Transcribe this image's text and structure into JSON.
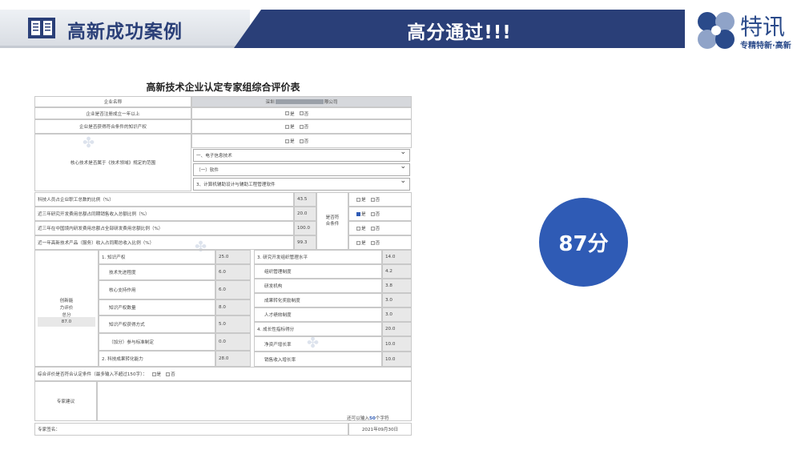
{
  "header": {
    "left_title": "高新成功案例",
    "mid_title": "高分通过!!!",
    "logo_name": "特讯",
    "logo_slogan": "专精特新·高新"
  },
  "score_badge": "87分",
  "form": {
    "title": "高新技术企业认定专家组综合评价表",
    "company_label": "企业名称",
    "company_value_left": "深圳",
    "company_value_right": "限公司",
    "row_reg_label": "企业是否注册成立一年以上",
    "row_ip_label": "企业是否获得符合条件的知识产权",
    "yes": "是",
    "no": "否",
    "tech_field_label": "核心技术是否属于《技术领域》规定的范围",
    "tech_field_1": "一、电子信息技术",
    "tech_field_2": "（一）软件",
    "tech_field_3": "3、计算机辅助设计与辅助工程管理软件",
    "ratio_rows": [
      {
        "label": "科技人员占企业职工总数的比例（%）",
        "value": "43.5"
      },
      {
        "label": "近三年研究开发费用总额占同期销售收入总额比例（%）",
        "value": "20.0"
      },
      {
        "label": "近三年在中国境内研发费用总额占全部研发费用总额比例（%）",
        "value": "100.0"
      },
      {
        "label": "近一年高新技术产品（服务）收入占同期总收入比例（%）",
        "value": "99.3"
      }
    ],
    "ratio_side_label": "是否符合条件",
    "innovation_label": "创新能力评价总分",
    "innovation_total": "87.0",
    "left_items": [
      {
        "label": "1. 知识产权",
        "value": "25.0"
      },
      {
        "label": "技术先进程度",
        "value": "6.0"
      },
      {
        "label": "核心支持作用",
        "value": "6.0"
      },
      {
        "label": "知识产权数量",
        "value": "8.0"
      },
      {
        "label": "知识产权获得方式",
        "value": "5.0"
      },
      {
        "label": "（加分）参与标准制定",
        "value": "0.0"
      },
      {
        "label": "2. 科技成果转化能力",
        "value": "28.0"
      }
    ],
    "right_items": [
      {
        "label": "3. 研究开发组织管理水平",
        "value": "14.0"
      },
      {
        "label": "组织管理制度",
        "value": "4.2"
      },
      {
        "label": "研发机构",
        "value": "3.8"
      },
      {
        "label": "成果转化奖励制度",
        "value": "3.0"
      },
      {
        "label": "人才绩效制度",
        "value": "3.0"
      },
      {
        "label": "4. 成长性指标得分",
        "value": "20.0"
      },
      {
        "label": "净资产增长率",
        "value": "10.0"
      },
      {
        "label": "销售收入增长率",
        "value": "10.0"
      }
    ],
    "overall_label": "综合评价是否符合认定条件（最多输入不超过150字）：",
    "expert_advice_label": "专家建议",
    "char_count_prefix": "还可以输入",
    "char_count_value": "50",
    "char_count_suffix": "个字符",
    "signature_label": "专家签名：",
    "date": "2021年09月30日"
  },
  "colors": {
    "navy": "#2a3f78",
    "accent_blue": "#2f5bb5"
  }
}
